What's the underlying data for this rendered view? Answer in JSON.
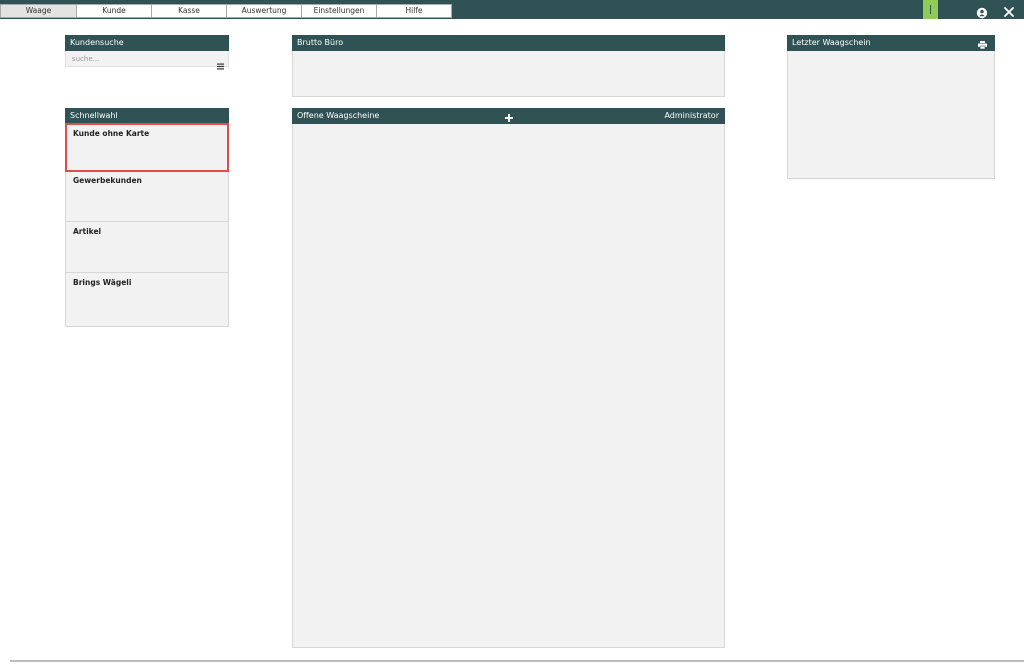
{
  "nav": {
    "tabs": [
      {
        "label": "Waage",
        "active": true
      },
      {
        "label": "Kunde",
        "active": false
      },
      {
        "label": "Kasse",
        "active": false
      },
      {
        "label": "Auswertung",
        "active": false
      },
      {
        "label": "Einstellungen",
        "active": false
      },
      {
        "label": "Hilfe",
        "active": false
      }
    ],
    "status_color": "#8fcb55",
    "icons": [
      "user-icon",
      "close-icon"
    ]
  },
  "kundensuche": {
    "title": "Kundensuche",
    "placeholder": "suche..."
  },
  "schnellwahl": {
    "title": "Schnellwahl",
    "items": [
      {
        "label": "Kunde ohne Karte",
        "selected": true
      },
      {
        "label": "Gewerbekunden",
        "selected": false
      },
      {
        "label": "Artikel",
        "selected": false
      },
      {
        "label": "Brings Wägeli",
        "selected": false
      }
    ]
  },
  "brutto": {
    "title": "Brutto Büro"
  },
  "offene": {
    "title": "Offene Waagscheine",
    "user": "Administrator"
  },
  "letzter": {
    "title": "Letzter Waagschein"
  },
  "colors": {
    "header_bg": "#2f5254",
    "panel_bg": "#f2f2f2",
    "selection": "#e04b4b"
  }
}
